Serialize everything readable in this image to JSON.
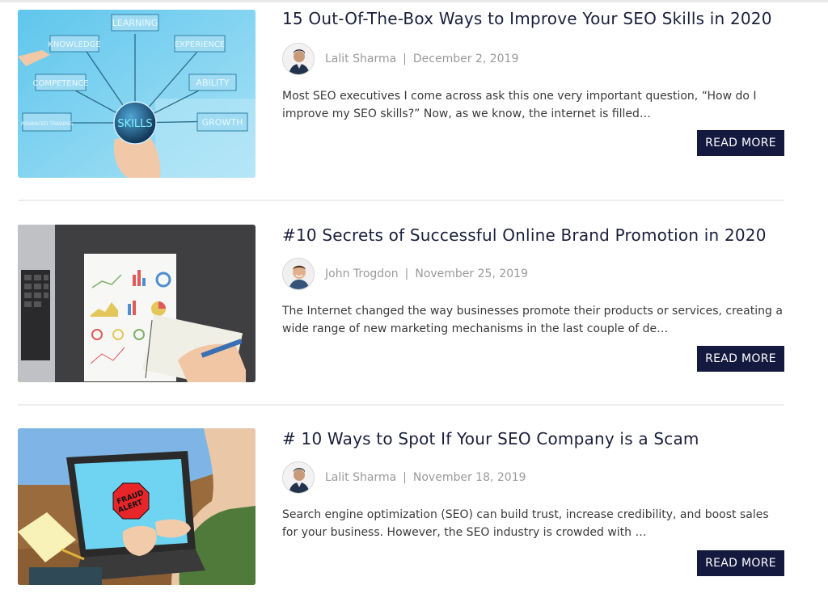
{
  "posts": [
    {
      "title": "15 Out-Of-The-Box Ways to Improve Your SEO Skills in 2020",
      "author": "Lalit Sharma",
      "separator": "|",
      "date": "December 2, 2019",
      "excerpt": "Most SEO executives I come across ask this one very important question, “How do I improve my SEO skills?” Now, as we know, the internet is filled…",
      "button": "READ MORE",
      "image": {
        "center_label": "SKILLS",
        "labels": [
          "LEARNING",
          "KNOWLEDGE",
          "EXPERIENCE",
          "COMPETENCE",
          "ABILITY",
          "ADVANCED TRAINING",
          "GROWTH"
        ]
      }
    },
    {
      "title": "#10 Secrets of Successful Online Brand Promotion in 2020",
      "author": "John Trogdon",
      "separator": "|",
      "date": "November 25, 2019",
      "excerpt": "The Internet changed the way businesses promote their products or services, creating a wide range of new marketing mechanisms in the last couple of de…",
      "button": "READ MORE"
    },
    {
      "title": "# 10 Ways to Spot If Your SEO Company is a Scam",
      "author": "Lalit Sharma",
      "separator": "|",
      "date": "November 18, 2019",
      "excerpt": "Search engine optimization (SEO) can build trust, increase credibility, and boost sales for your business. However, the SEO industry is crowded with …",
      "button": "READ MORE",
      "image": {
        "sign_line1": "FRAUD",
        "sign_line2": "ALERT"
      }
    }
  ],
  "colors": {
    "title": "#1b1f3b",
    "button_bg": "#141a3f",
    "meta": "#9a9a9a",
    "divider": "#ececec"
  }
}
